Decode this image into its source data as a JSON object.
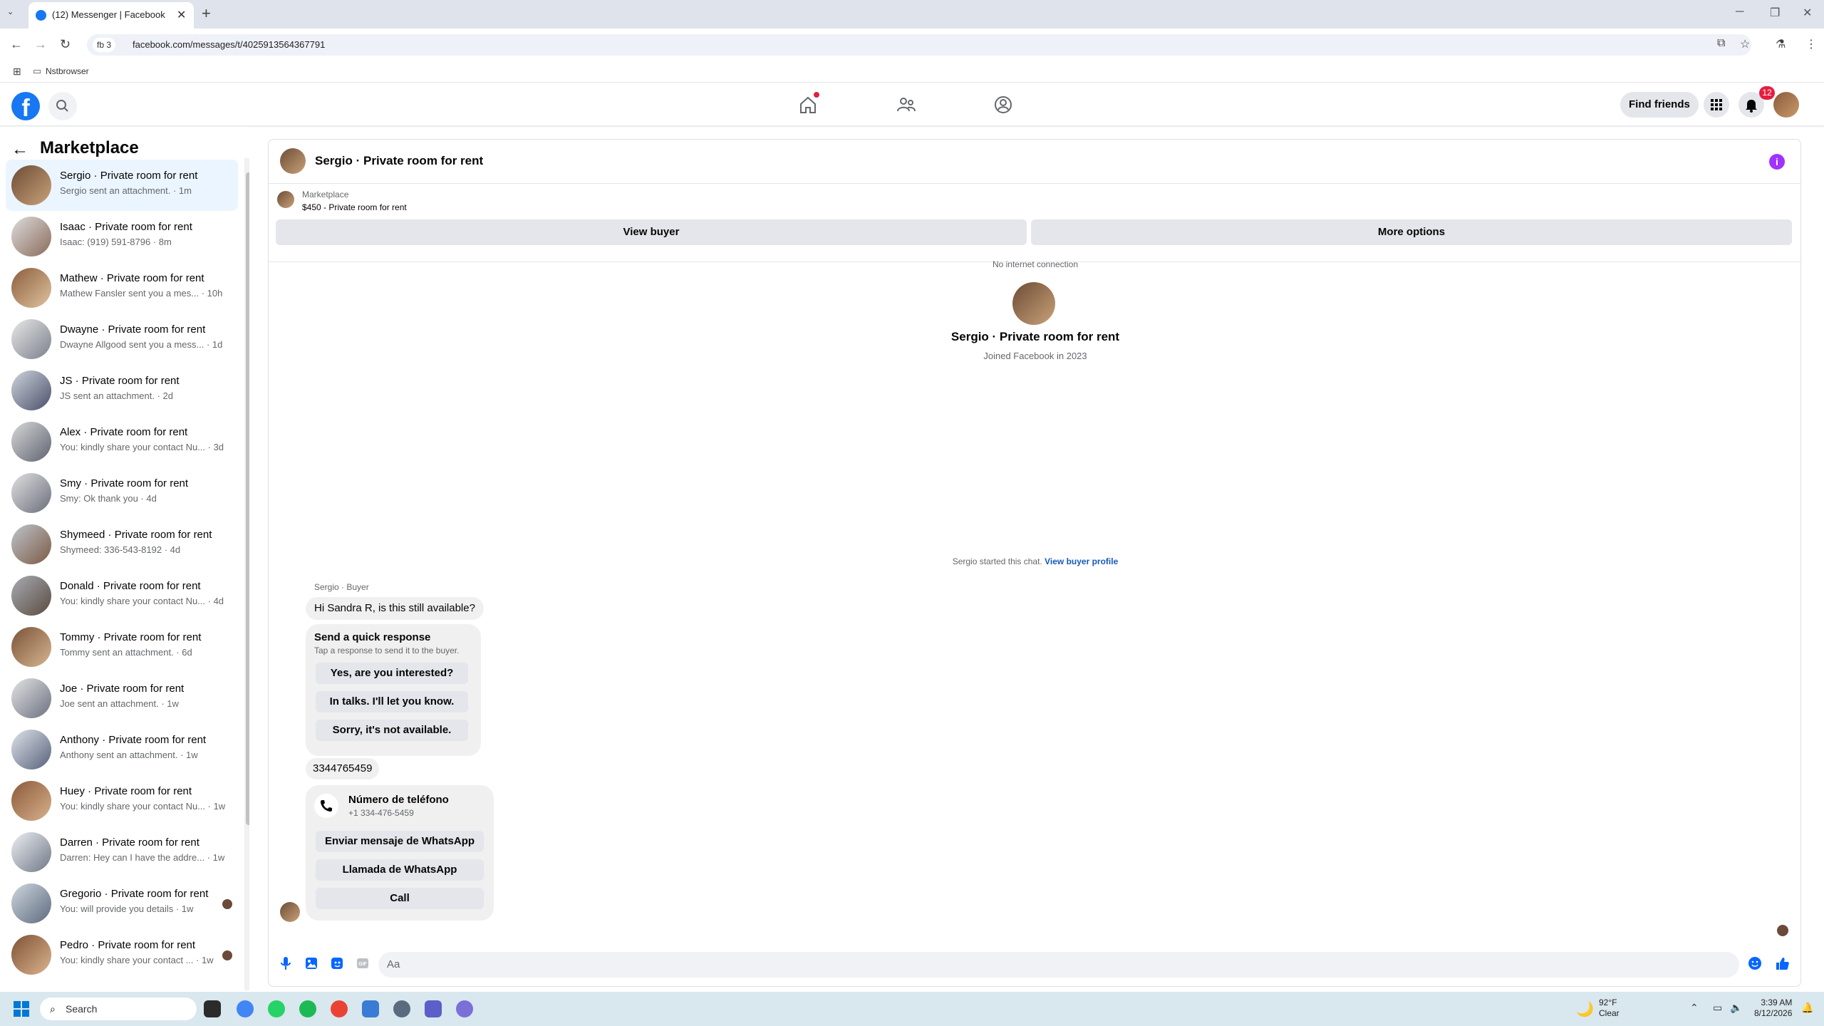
{
  "browser": {
    "tab_title": "(12) Messenger | Facebook",
    "url": "facebook.com/messages/t/4025913564367791",
    "site_chip": "fb 3",
    "bookmark": "Nstbrowser"
  },
  "fb": {
    "find_friends": "Find friends",
    "notification_count": "12",
    "brand_color": "#1877f2"
  },
  "sidebar": {
    "title": "Marketplace",
    "conversations": [
      {
        "name": "Sergio · Private room for rent",
        "preview": "Sergio sent an attachment. · 1m"
      },
      {
        "name": "Isaac · Private room for rent",
        "preview": "Isaac: (919) 591-8796 · 8m"
      },
      {
        "name": "Mathew · Private room for rent",
        "preview": "Mathew Fansler sent you a mes... · 10h"
      },
      {
        "name": "Dwayne · Private room for rent",
        "preview": "Dwayne Allgood sent you a mess... · 1d"
      },
      {
        "name": "JS · Private room for rent",
        "preview": "JS sent an attachment. · 2d"
      },
      {
        "name": "Alex · Private room for rent",
        "preview": "You: kindly share your contact Nu... · 3d"
      },
      {
        "name": "Smy · Private room for rent",
        "preview": "Smy: Ok thank you · 4d"
      },
      {
        "name": "Shymeed · Private room for rent",
        "preview": "Shymeed: 336-543-8192 · 4d"
      },
      {
        "name": "Donald · Private room for rent",
        "preview": "You: kindly share your contact Nu... · 4d"
      },
      {
        "name": "Tommy · Private room for rent",
        "preview": "Tommy sent an attachment. · 6d"
      },
      {
        "name": "Joe · Private room for rent",
        "preview": "Joe sent an attachment. · 1w"
      },
      {
        "name": "Anthony · Private room for rent",
        "preview": "Anthony sent an attachment. · 1w"
      },
      {
        "name": "Huey · Private room for rent",
        "preview": "You: kindly share your contact Nu... · 1w"
      },
      {
        "name": "Darren · Private room for rent",
        "preview": "Darren: Hey can I have the addre... · 1w"
      },
      {
        "name": "Gregorio · Private room for rent",
        "preview": "You: will provide you details · 1w"
      },
      {
        "name": "Pedro · Private room for rent",
        "preview": "You: kindly share your contact ... · 1w"
      }
    ]
  },
  "chat": {
    "header_name": "Sergio · Private room for rent",
    "listing_label": "Marketplace",
    "listing_price": "$450 - Private room for rent",
    "view_buyer": "View buyer",
    "more_options": "More options",
    "no_connection": "No internet connection",
    "profile_name": "Sergio · Private room for rent",
    "joined": "Joined Facebook in 2023",
    "started_text": "Sergio started this chat.",
    "view_buyer_profile": "View buyer profile",
    "sender_label": "Sergio · Buyer",
    "first_message": "Hi Sandra R, is this still available?",
    "quick_title": "Send a quick response",
    "quick_sub": "Tap a response to send it to the buyer.",
    "quick_responses": [
      "Yes, are you interested?",
      "In talks. I'll let you know.",
      "Sorry, it's not available."
    ],
    "number_message": "3344765459",
    "phone_title": "Número de teléfono",
    "phone_number": "+1 334-476-5459",
    "phone_actions": [
      "Enviar mensaje de WhatsApp",
      "Llamada de WhatsApp",
      "Call"
    ],
    "input_placeholder": "Aa"
  },
  "taskbar": {
    "search": "Search",
    "temp": "92°F",
    "condition": "Clear",
    "time": "3:39 AM",
    "date": "8/12/2026"
  }
}
